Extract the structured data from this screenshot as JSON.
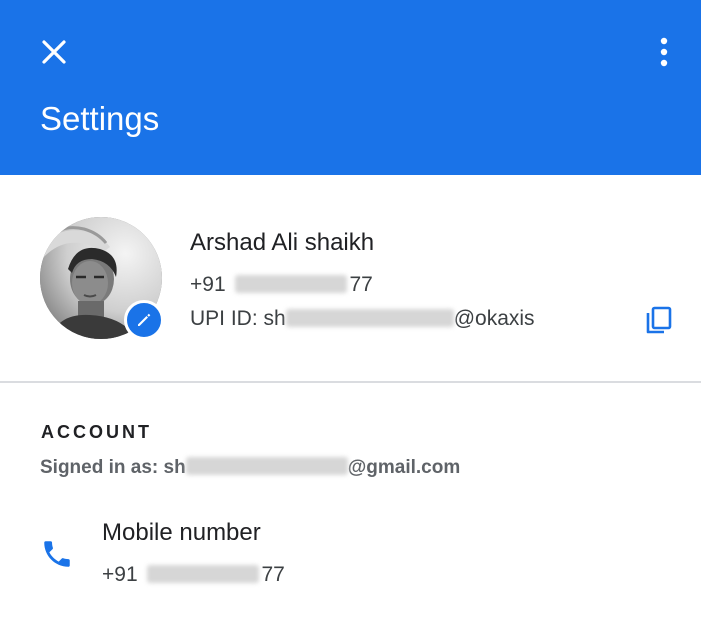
{
  "header": {
    "title": "Settings",
    "close_icon": "close-icon",
    "more_icon": "more-vert-icon",
    "background": "#1a73e8"
  },
  "profile": {
    "name": "Arshad Ali shaikh",
    "phone_prefix": "+91",
    "phone_suffix": "77",
    "upi_label": "UPI ID: ",
    "upi_start": "sh",
    "upi_domain": "@okaxis",
    "edit_icon": "edit-pencil-icon",
    "copy_icon": "copy-icon"
  },
  "account": {
    "heading": "ACCOUNT",
    "signed_in_label": "Signed in as: ",
    "email_start": "sh",
    "email_domain": "@gmail.com",
    "mobile": {
      "label": "Mobile number",
      "prefix": "+91",
      "suffix": "77",
      "icon": "phone-icon"
    }
  },
  "colors": {
    "accent": "#1a73e8",
    "divider": "#dadce0",
    "secondary_text": "#5f6368"
  }
}
